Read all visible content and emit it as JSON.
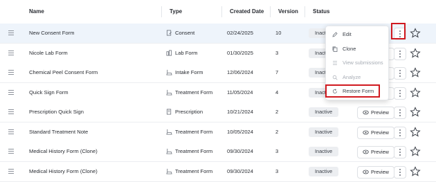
{
  "columns": [
    "Name",
    "Type",
    "Created Date",
    "Version",
    "Status"
  ],
  "preview_label": "Preview",
  "rows": [
    {
      "name": "New Consent Form",
      "type": "Consent",
      "type_icon": "consent-icon",
      "date": "02/24/2025",
      "version": "10",
      "status": "Inactive"
    },
    {
      "name": "Nicole Lab Form",
      "type": "Lab Form",
      "type_icon": "lab-icon",
      "date": "01/30/2025",
      "version": "3",
      "status": "Inactive"
    },
    {
      "name": "Chemical Peel Consent Form",
      "type": "Intake Form",
      "type_icon": "intake-icon",
      "date": "12/06/2024",
      "version": "7",
      "status": "Inactive"
    },
    {
      "name": "Quick Sign Form",
      "type": "Treatment Form",
      "type_icon": "treatment-icon",
      "date": "11/05/2024",
      "version": "4",
      "status": "Inactive"
    },
    {
      "name": "Prescription Quick Sign",
      "type": "Prescription",
      "type_icon": "prescription-icon",
      "date": "10/21/2024",
      "version": "2",
      "status": "Inactive"
    },
    {
      "name": "Standard Treatment Note",
      "type": "Treatment Form",
      "type_icon": "treatment-icon",
      "date": "10/05/2024",
      "version": "2",
      "status": "Inactive"
    },
    {
      "name": "Medical History Form (Clone)",
      "type": "Treatment Form",
      "type_icon": "treatment-icon",
      "date": "09/30/2024",
      "version": "3",
      "status": "Inactive"
    },
    {
      "name": "Medical History Form (Clone)",
      "type": "Treatment Form",
      "type_icon": "treatment-icon",
      "date": "09/30/2024",
      "version": "3",
      "status": "Inactive"
    }
  ],
  "menu": [
    {
      "label": "Edit",
      "icon": "pencil-icon",
      "disabled": false
    },
    {
      "label": "Clone",
      "icon": "copy-icon",
      "disabled": false
    },
    {
      "label": "View submissions",
      "icon": "list-icon",
      "disabled": true
    },
    {
      "label": "Analyze",
      "icon": "analyze-icon",
      "disabled": true
    },
    {
      "label": "Restore Form",
      "icon": "restore-icon",
      "disabled": false
    }
  ],
  "colors": {
    "highlight": "#d0191f",
    "selected_row": "#eef4fb",
    "status_bg": "#eceef1"
  }
}
